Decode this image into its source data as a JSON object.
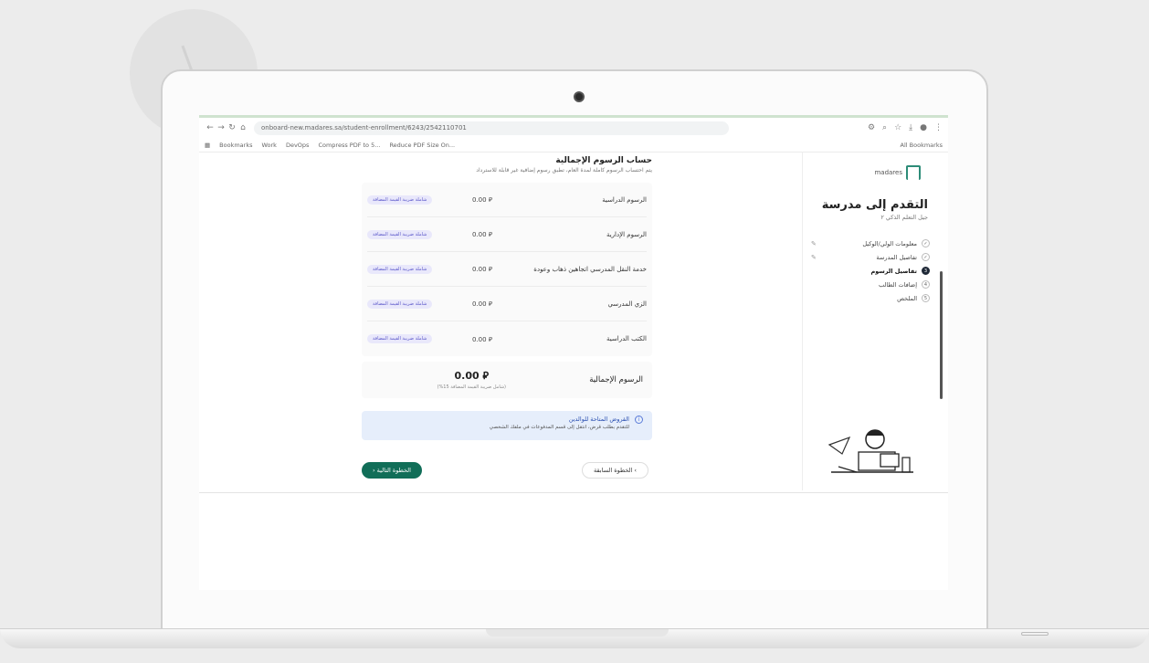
{
  "browser": {
    "url": "onboard-new.madares.sa/student-enrollment/6243/2542110701",
    "bookmarks": [
      "Bookmarks",
      "Work",
      "DevOps",
      "Compress PDF to 5...",
      "Reduce PDF Size On..."
    ],
    "all_bookmarks": "All Bookmarks"
  },
  "sidebar": {
    "logo_text": "madares",
    "title": "التقدم إلى مدرسة",
    "subtitle": "جيل التعلم الذكي ٢",
    "steps": [
      {
        "num": "",
        "label": "معلومات الولي/الوكيل"
      },
      {
        "num": "",
        "label": "تفاصيل المدرسة"
      },
      {
        "num": "3",
        "label": "تفاصيل الرسوم"
      },
      {
        "num": "4",
        "label": "إضافات الطالب"
      },
      {
        "num": "5",
        "label": "الملخص"
      }
    ]
  },
  "main": {
    "title": "حساب الرسوم الإجمالية",
    "description": "يتم احتساب الرسوم كاملة لمدة العام، تطبق رسوم إضافية غير قابلة للاسترداد",
    "fees": [
      {
        "name": "الرسوم الدراسية",
        "amount": "⃁ 0.00",
        "badge": "شاملة ضريبة القيمة المضافة"
      },
      {
        "name": "الرسوم الإدارية",
        "amount": "⃁ 0.00",
        "badge": "شاملة ضريبة القيمة المضافة"
      },
      {
        "name": "خدمة النقل المدرسي اتجاهين ذهاب وعودة",
        "amount": "⃁ 0.00",
        "badge": "شاملة ضريبة القيمة المضافة"
      },
      {
        "name": "الزي المدرسي",
        "amount": "⃁ 0.00",
        "badge": "شاملة ضريبة القيمة المضافة"
      },
      {
        "name": "الكتب الدراسية",
        "amount": "⃁ 0.00",
        "badge": "شاملة ضريبة القيمة المضافة"
      }
    ],
    "total_label": "الرسوم الإجمالية",
    "total_value": "⃁ 0.00",
    "total_note": "(شامل ضريبة القيمة المضافة 15%)",
    "loan_title": "القروض المتاحة للوالدين",
    "loan_text": "للتقدم بطلب قرض، انتقل إلى قسم المدفوعات في ملفك الشخصي",
    "prev_label": "الخطوة السابقة",
    "next_label": "الخطوة التالية"
  }
}
